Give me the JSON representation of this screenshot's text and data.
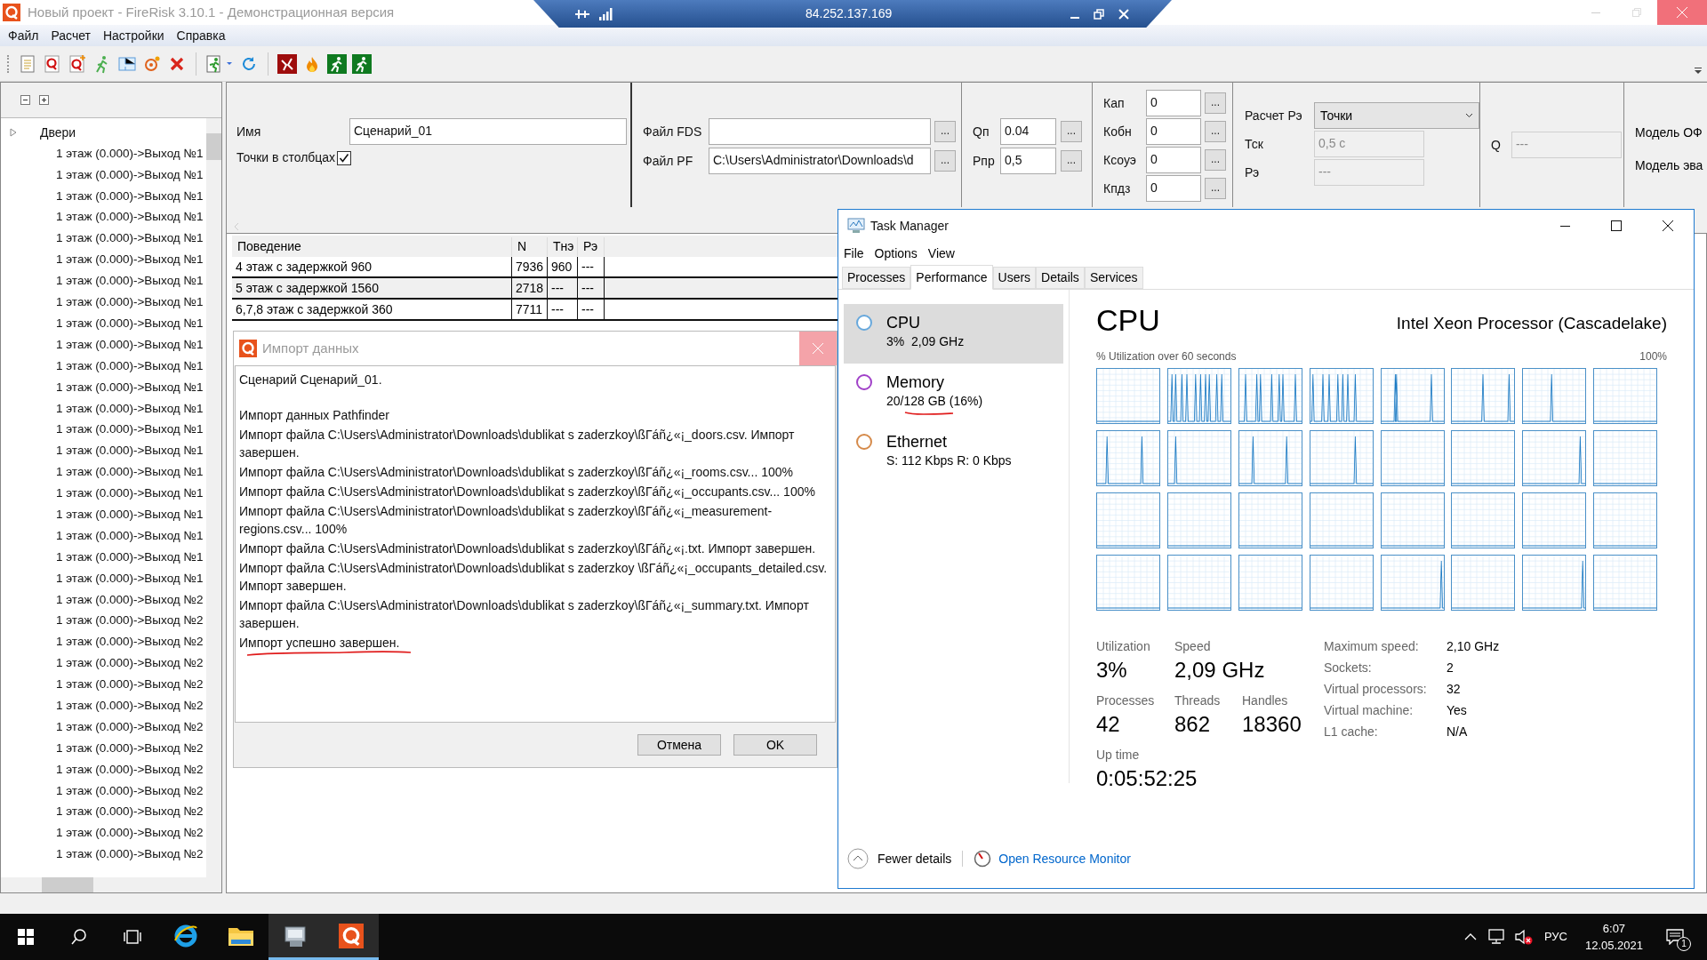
{
  "window": {
    "title": "Новый проект - FireRisk 3.10.1 - Демонстрационная версия"
  },
  "remote_bar": {
    "address": "84.252.137.169"
  },
  "menu": [
    "Файл",
    "Расчет",
    "Настройки",
    "Справка"
  ],
  "toolbar": [
    {
      "kind": "doc"
    },
    {
      "kind": "q"
    },
    {
      "kind": "qplus"
    },
    {
      "kind": "runner"
    },
    {
      "kind": "plan"
    },
    {
      "kind": "target"
    },
    {
      "kind": "delete"
    },
    {
      "kind": "sep"
    },
    {
      "kind": "exit"
    },
    {
      "kind": "refresh"
    },
    {
      "kind": "sep"
    },
    {
      "kind": "red"
    },
    {
      "kind": "fire"
    },
    {
      "kind": "green"
    },
    {
      "kind": "green"
    }
  ],
  "tree": {
    "root": "Двери",
    "items": [
      "1 этаж (0.000)->Выход №1",
      "1 этаж (0.000)->Выход №1",
      "1 этаж (0.000)->Выход №1",
      "1 этаж (0.000)->Выход №1",
      "1 этаж (0.000)->Выход №1",
      "1 этаж (0.000)->Выход №1",
      "1 этаж (0.000)->Выход №1",
      "1 этаж (0.000)->Выход №1",
      "1 этаж (0.000)->Выход №1",
      "1 этаж (0.000)->Выход №1",
      "1 этаж (0.000)->Выход №1",
      "1 этаж (0.000)->Выход №1",
      "1 этаж (0.000)->Выход №1",
      "1 этаж (0.000)->Выход №1",
      "1 этаж (0.000)->Выход №1",
      "1 этаж (0.000)->Выход №1",
      "1 этаж (0.000)->Выход №1",
      "1 этаж (0.000)->Выход №1",
      "1 этаж (0.000)->Выход №1",
      "1 этаж (0.000)->Выход №1",
      "1 этаж (0.000)->Выход №1",
      "1 этаж (0.000)->Выход №2",
      "1 этаж (0.000)->Выход №2",
      "1 этаж (0.000)->Выход №2",
      "1 этаж (0.000)->Выход №2",
      "1 этаж (0.000)->Выход №2",
      "1 этаж (0.000)->Выход №2",
      "1 этаж (0.000)->Выход №2",
      "1 этаж (0.000)->Выход №2",
      "1 этаж (0.000)->Выход №2",
      "1 этаж (0.000)->Выход №2",
      "1 этаж (0.000)->Выход №2",
      "1 этаж (0.000)->Выход №2",
      "1 этаж (0.000)->Выход №2"
    ]
  },
  "form": {
    "name_label": "Имя",
    "name_value": "Сценарий_01",
    "columns_label": "Точки в столбцах",
    "columns_checked": true,
    "files": [
      {
        "label": "Файл FDS",
        "button": "..."
      },
      {
        "label": "Файл PF",
        "value": "C:\\Users\\Administrator\\Downloads\\d",
        "button": "..."
      }
    ],
    "loads": [
      {
        "label": "Qп",
        "value": "0.04",
        "button": "..."
      },
      {
        "label": "Pпр",
        "value": "0,5",
        "button": "..."
      }
    ],
    "coefficients": [
      {
        "label": "Кап",
        "value": "0",
        "button": "..."
      },
      {
        "label": "Кобн",
        "value": "0",
        "button": "..."
      },
      {
        "label": "Ксоуэ",
        "value": "0",
        "button": "..."
      },
      {
        "label": "Кпдз",
        "value": "0",
        "button": "..."
      }
    ],
    "pe_calc": {
      "label": "Расчет Рэ",
      "value": "Точки"
    },
    "params": [
      {
        "label": "Тск",
        "value": "0,5 с",
        "disabled": true
      },
      {
        "label": "Рэ",
        "value": "---",
        "disabled": true
      }
    ],
    "q": {
      "label": "Q",
      "value": "---",
      "disabled": true
    },
    "models": [
      "Модель ОФ",
      "Модель эва"
    ]
  },
  "table": {
    "columns": [
      "Поведение",
      "N",
      "Тнэ",
      "Рэ"
    ],
    "rows": [
      [
        "4 этаж с задержкой 960",
        "7936",
        "960",
        "---"
      ],
      [
        "5 этаж с задержкой 1560",
        "2718",
        "---",
        "---"
      ],
      [
        "6,7,8 этаж с задержкой 360",
        "7711",
        "---",
        "---"
      ]
    ]
  },
  "import_dialog": {
    "title": "Импорт данных",
    "lines": [
      {
        "text": "Сценарий Сценарий_01.",
        "underlined": false
      },
      {
        "text": "Импорт данных Pathfinder",
        "underlined": false
      },
      {
        "text": "Импорт файла C:\\Users\\Administrator\\Downloads\\dublikat s zaderzkoy\\ßГáñ¿«¡_doors.csv. Импорт завершен.",
        "underlined": false
      },
      {
        "text": "Импорт файла C:\\Users\\Administrator\\Downloads\\dublikat s zaderzkoy\\ßГáñ¿«¡_rooms.csv... 100%",
        "underlined": false
      },
      {
        "text": "Импорт файла C:\\Users\\Administrator\\Downloads\\dublikat s zaderzkoy\\ßГáñ¿«¡_occupants.csv... 100%",
        "underlined": false
      },
      {
        "text": "Импорт файла C:\\Users\\Administrator\\Downloads\\dublikat s zaderzkoy\\ßГáñ¿«¡_measurement-regions.csv... 100%",
        "underlined": false
      },
      {
        "text": "Импорт файла C:\\Users\\Administrator\\Downloads\\dublikat s zaderzkoy\\ßГáñ¿«¡.txt. Импорт завершен.",
        "underlined": false
      },
      {
        "text": "Импорт файла C:\\Users\\Administrator\\Downloads\\dublikat s zaderzkoy \\ßГáñ¿«¡_occupants_detailed.csv. Импорт завершен.",
        "underlined": false
      },
      {
        "text": "Импорт файла C:\\Users\\Administrator\\Downloads\\dublikat s zaderzkoy\\ßГáñ¿«¡_summary.txt. Импорт завершен.",
        "underlined": false
      },
      {
        "text": "Импорт успешно завершен.",
        "underlined": true
      }
    ],
    "buttons": [
      "Отмена",
      "OK"
    ]
  },
  "task_manager": {
    "title": "Task Manager",
    "menu": [
      "File",
      "Options",
      "View"
    ],
    "tabs": [
      {
        "label": "Processes",
        "selected": false
      },
      {
        "label": "Performance",
        "selected": true
      },
      {
        "label": "Users",
        "selected": false
      },
      {
        "label": "Details",
        "selected": false
      },
      {
        "label": "Services",
        "selected": false
      }
    ],
    "resources": [
      {
        "name": "CPU",
        "detail": "3%  2,09 GHz",
        "color": "#67a8dc",
        "selected": true,
        "underlined": false
      },
      {
        "name": "Memory",
        "detail": "20/128 GB (16%)",
        "color": "#a040c8",
        "selected": false,
        "underlined": true
      },
      {
        "name": "Ethernet",
        "detail": "S: 112 Kbps R: 0 Kbps",
        "color": "#d58a4a",
        "selected": false,
        "underlined": false
      }
    ],
    "heading": "CPU",
    "model": "Intel Xeon Processor (Cascadelake)",
    "graph_caption": "% Utilization over 60 seconds",
    "graph_max": "100%",
    "stats": [
      [
        {
          "label": "Utilization",
          "value": "3%"
        },
        {
          "label": "Speed",
          "value": "2,09 GHz"
        }
      ],
      [
        {
          "label": "Processes",
          "value": "42"
        },
        {
          "label": "Threads",
          "value": "862"
        },
        {
          "label": "Handles",
          "value": "18360"
        }
      ],
      [
        {
          "label": "Up time",
          "value": "0:05:52:25"
        }
      ]
    ],
    "specs": [
      {
        "label": "Maximum speed:",
        "value": "2,10 GHz"
      },
      {
        "label": "Sockets:",
        "value": "2"
      },
      {
        "label": "Virtual processors:",
        "value": "32"
      },
      {
        "label": "Virtual machine:",
        "value": "Yes"
      },
      {
        "label": "L1 cache:",
        "value": "N/A"
      }
    ],
    "fewer_details": "Fewer details",
    "resource_monitor": "Open Resource Monitor"
  },
  "taskbar": {
    "apps": [
      {
        "kind": "ie",
        "active": false
      },
      {
        "kind": "folder",
        "active": false
      },
      {
        "kind": "server",
        "active": true
      },
      {
        "kind": "q",
        "active": true
      }
    ],
    "language": "РУС",
    "time": "6:07",
    "date": "12.05.2021",
    "notifications": "1"
  }
}
